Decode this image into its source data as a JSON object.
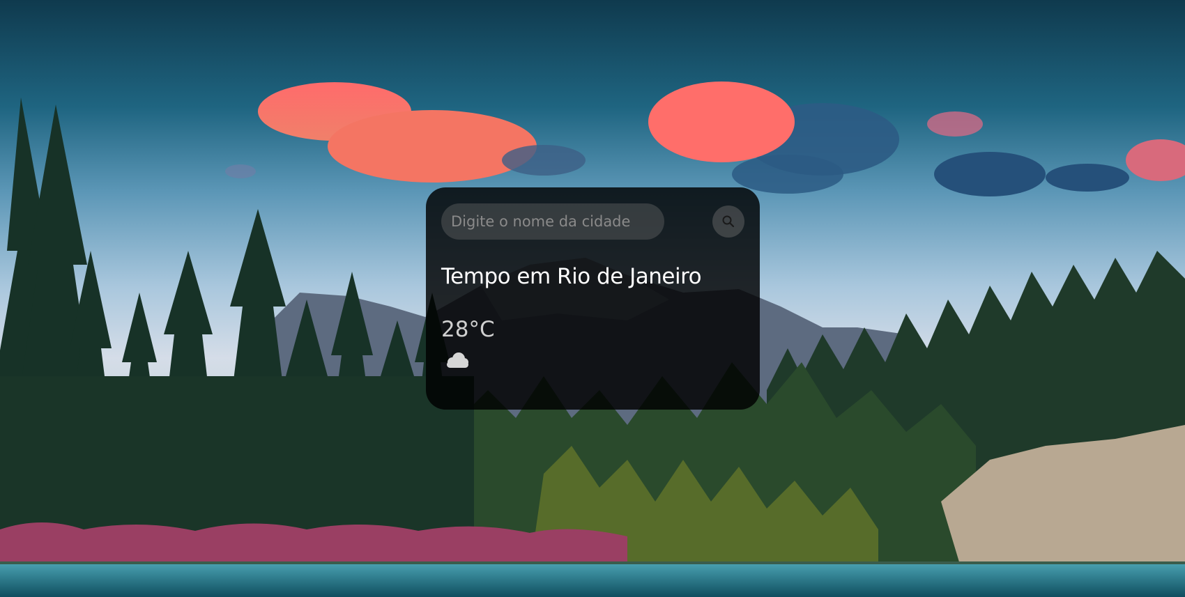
{
  "search": {
    "placeholder": "Digite o nome da cidade",
    "value": "",
    "button_icon": "search-icon"
  },
  "weather": {
    "title": "Tempo em Rio de Janeiro",
    "temperature": "28°C",
    "condition_icon": "cloud-icon"
  },
  "colors": {
    "card_background": "#000000",
    "text_primary": "#ffffff",
    "text_secondary": "#d0d0d0"
  }
}
